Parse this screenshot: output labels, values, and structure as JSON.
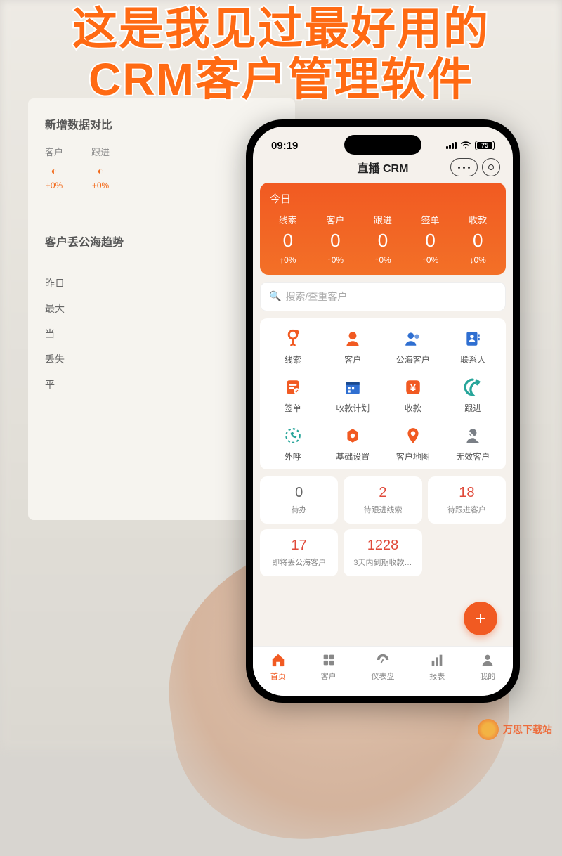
{
  "headline": {
    "line1": "这是我见过最好用的",
    "line2": "CRM客户管理软件"
  },
  "status": {
    "time": "09:19",
    "battery": "75"
  },
  "app": {
    "title": "直播 CRM"
  },
  "today": {
    "label": "今日",
    "metrics": [
      {
        "label": "线索",
        "value": "0",
        "pct": "↑0%"
      },
      {
        "label": "客户",
        "value": "0",
        "pct": "↑0%"
      },
      {
        "label": "跟进",
        "value": "0",
        "pct": "↑0%"
      },
      {
        "label": "签单",
        "value": "0",
        "pct": "↑0%"
      },
      {
        "label": "收款",
        "value": "0",
        "pct": "↓0%"
      }
    ]
  },
  "search": {
    "placeholder": "搜索/查重客户"
  },
  "grid": [
    {
      "label": "线索",
      "icon": "leads-icon",
      "color": "#f15a22"
    },
    {
      "label": "客户",
      "icon": "customer-icon",
      "color": "#f15a22"
    },
    {
      "label": "公海客户",
      "icon": "public-icon",
      "color": "#2f6fd1"
    },
    {
      "label": "联系人",
      "icon": "contact-icon",
      "color": "#2f6fd1"
    },
    {
      "label": "签单",
      "icon": "order-icon",
      "color": "#f15a22"
    },
    {
      "label": "收款计划",
      "icon": "plan-icon",
      "color": "#2f6fd1"
    },
    {
      "label": "收款",
      "icon": "payment-icon",
      "color": "#f15a22"
    },
    {
      "label": "跟进",
      "icon": "follow-icon",
      "color": "#27a59a"
    },
    {
      "label": "外呼",
      "icon": "call-icon",
      "color": "#27a59a"
    },
    {
      "label": "基础设置",
      "icon": "gear-icon",
      "color": "#f15a22"
    },
    {
      "label": "客户地图",
      "icon": "pin-icon",
      "color": "#f15a22"
    },
    {
      "label": "无效客户",
      "icon": "invalid-icon",
      "color": "#7a7f86"
    }
  ],
  "stats": [
    {
      "value": "0",
      "label": "待办",
      "tone": "gray"
    },
    {
      "value": "2",
      "label": "待跟进线索",
      "tone": "red"
    },
    {
      "value": "18",
      "label": "待跟进客户",
      "tone": "red"
    },
    {
      "value": "17",
      "label": "即将丢公海客户",
      "tone": "red"
    },
    {
      "value": "1228",
      "label": "3天内到期收款…",
      "tone": "red"
    }
  ],
  "tabs": [
    {
      "label": "首页",
      "icon": "home-icon",
      "active": true
    },
    {
      "label": "客户",
      "icon": "people-icon",
      "active": false
    },
    {
      "label": "仪表盘",
      "icon": "dashboard-icon",
      "active": false
    },
    {
      "label": "报表",
      "icon": "report-icon",
      "active": false
    },
    {
      "label": "我的",
      "icon": "profile-icon",
      "active": false
    }
  ],
  "desktop": {
    "section1_title": "新增数据对比",
    "metrics": [
      {
        "label": "客户",
        "pct": "+0%"
      },
      {
        "label": "跟进",
        "pct": "+0%"
      }
    ],
    "section2_title": "客户丢公海趋势",
    "list": [
      "昨日",
      "最大",
      "当",
      "丢失",
      "平"
    ]
  },
  "watermark": {
    "text": "万思下载站"
  }
}
